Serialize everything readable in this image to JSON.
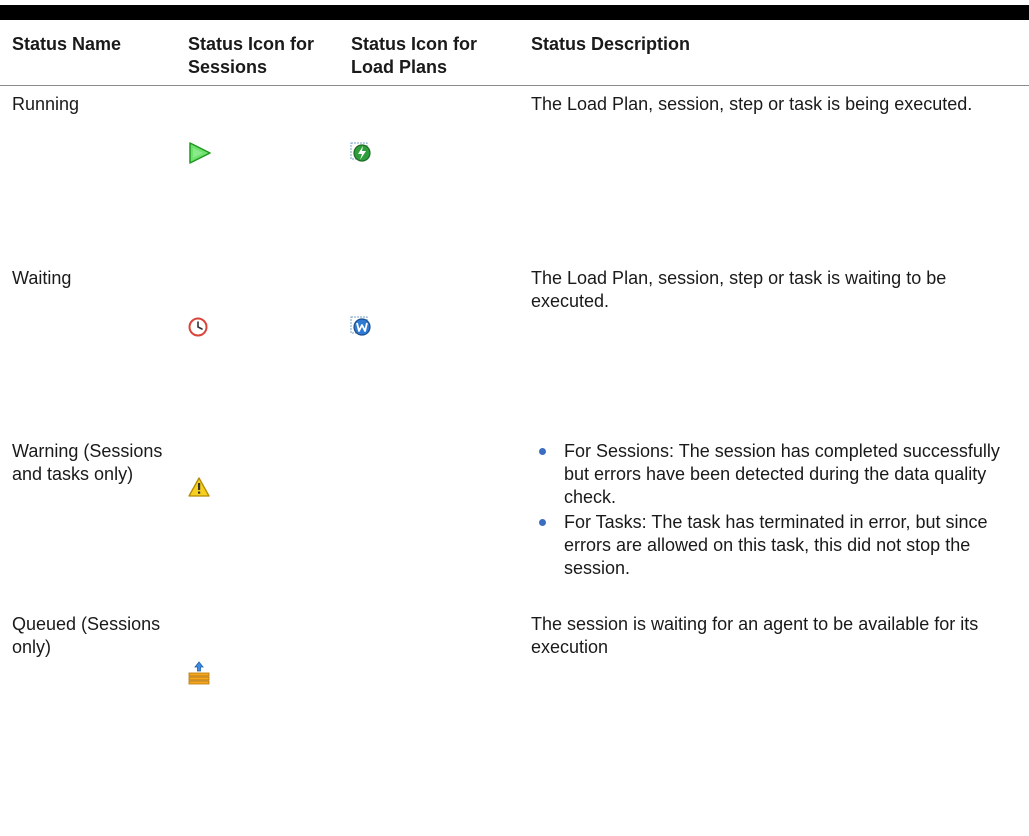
{
  "table": {
    "headers": {
      "status_name": "Status Name",
      "status_icon_sessions": "Status Icon for Sessions",
      "status_icon_load_plans": "Status Icon for Load Plans",
      "status_description": "Status Description"
    },
    "rows": {
      "running": {
        "name": "Running",
        "session_icon": "play-arrow-icon",
        "load_plan_icon": "running-load-plan-icon",
        "description": "The Load Plan, session, step or task is being executed."
      },
      "waiting": {
        "name": "Waiting",
        "session_icon": "clock-icon",
        "load_plan_icon": "waiting-load-plan-icon",
        "description": "The Load Plan, session, step or task is waiting to be executed."
      },
      "warning": {
        "name": "Warning (Sessions and tasks only)",
        "session_icon": "warning-triangle-icon",
        "description_items": [
          "For Sessions: The session has completed successfully but errors have been detected during the data quality check.",
          "For Tasks: The task has terminated in error, but since errors are allowed on this task, this did not stop the session."
        ]
      },
      "queued": {
        "name": "Queued (Sessions only)",
        "session_icon": "queue-stack-icon",
        "description": "The session is waiting for an agent to be available for its execution"
      }
    }
  },
  "colors": {
    "header_rule": "#000000",
    "bullet": "#3b6ec1",
    "running_icon": "#2fbf2f",
    "waiting_icon": "#d9453a",
    "warning_icon": "#f2c200",
    "queued_icon": "#f5a623"
  }
}
